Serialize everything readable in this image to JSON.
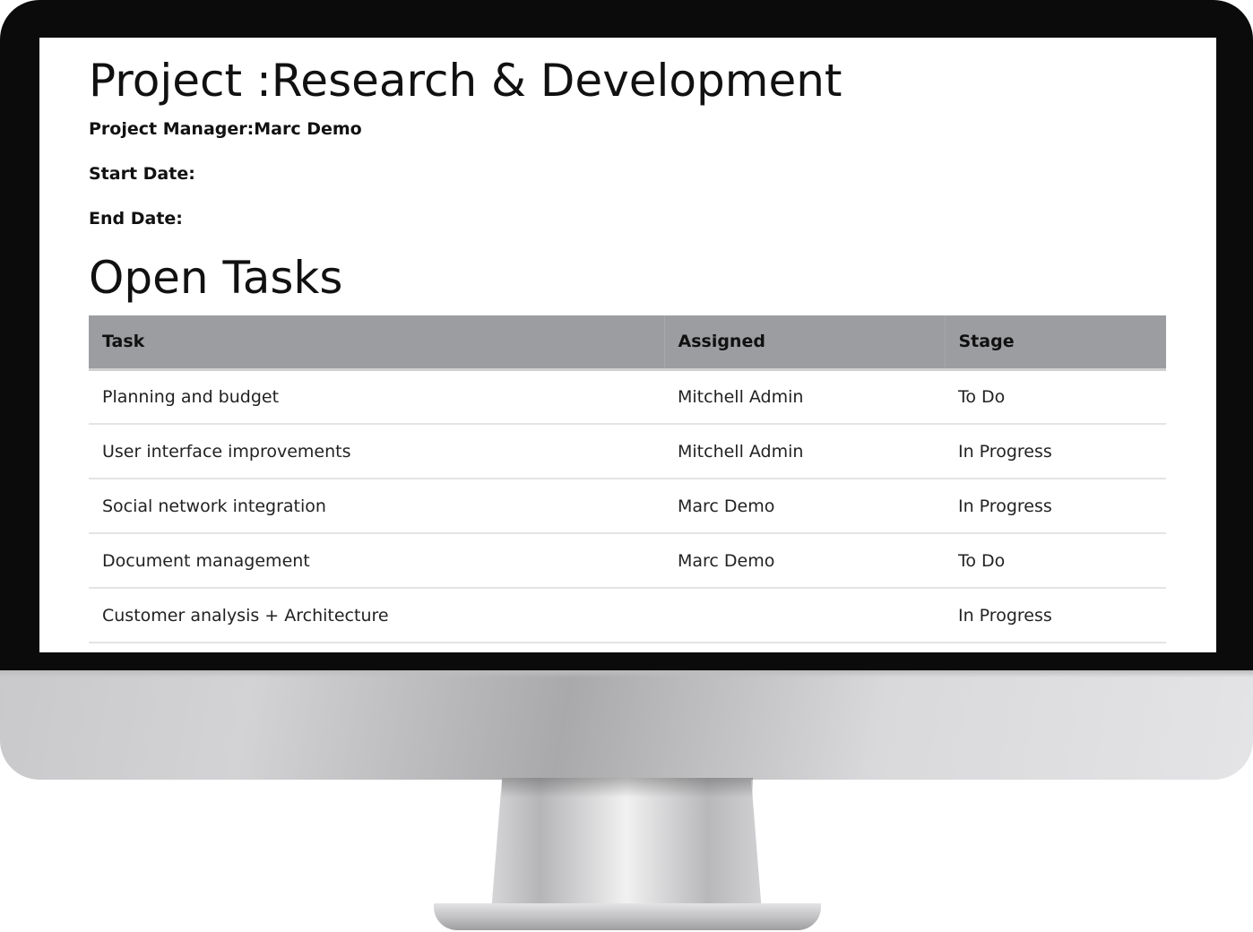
{
  "project": {
    "title": "Project :Research & Development",
    "manager_line": "Project Manager:Marc Demo",
    "start_date_line": "Start Date:",
    "end_date_line": "End Date:"
  },
  "open_tasks": {
    "heading": "Open Tasks",
    "columns": [
      "Task",
      "Assigned",
      "Stage"
    ],
    "rows": [
      {
        "task": "Planning and budget",
        "assigned": "Mitchell Admin",
        "stage": "To Do"
      },
      {
        "task": "User interface improvements",
        "assigned": "Mitchell Admin",
        "stage": "In Progress"
      },
      {
        "task": "Social network integration",
        "assigned": "Marc Demo",
        "stage": "In Progress"
      },
      {
        "task": "Document management",
        "assigned": "Marc Demo",
        "stage": "To Do"
      },
      {
        "task": "Customer analysis + Architecture",
        "assigned": "",
        "stage": "In Progress"
      }
    ]
  },
  "colors": {
    "table_header_bg": "#9c9da0",
    "monitor_bezel": "#0b0b0b",
    "monitor_chin": "#c9c9cb"
  }
}
